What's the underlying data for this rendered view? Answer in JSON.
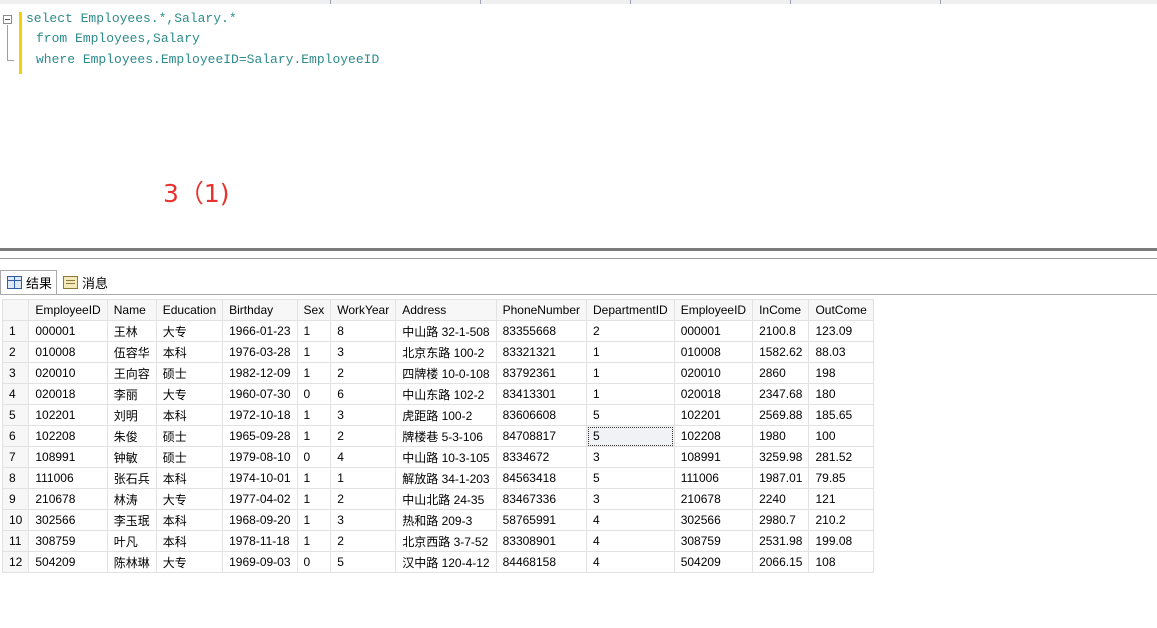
{
  "editor": {
    "lines": [
      {
        "keyword": "select",
        "rest": " Employees.*,Salary.*"
      },
      {
        "keyword": "from",
        "rest": " Employees,Salary"
      },
      {
        "keyword": "where",
        "rest": " Employees.EmployeeID=Salary.EmployeeID"
      }
    ],
    "annotation": "3（1)"
  },
  "result_tabs": [
    {
      "label": "结果",
      "icon": "grid-icon"
    },
    {
      "label": "消息",
      "icon": "message-icon"
    }
  ],
  "grid": {
    "columns": [
      "",
      "EmployeeID",
      "Name",
      "Education",
      "Birthday",
      "Sex",
      "WorkYear",
      "Address",
      "PhoneNumber",
      "DepartmentID",
      "EmployeeID",
      "InCome",
      "OutCome"
    ],
    "rows": [
      [
        "1",
        "000001",
        "王林",
        "大专",
        "1966-01-23",
        "1",
        "8",
        "中山路 32-1-508",
        "83355668",
        "2",
        "000001",
        "2100.8",
        "123.09"
      ],
      [
        "2",
        "010008",
        "伍容华",
        "本科",
        "1976-03-28",
        "1",
        "3",
        "北京东路 100-2",
        "83321321",
        "1",
        "010008",
        "1582.62",
        "88.03"
      ],
      [
        "3",
        "020010",
        "王向容",
        "硕士",
        "1982-12-09",
        "1",
        "2",
        "四牌楼 10-0-108",
        "83792361",
        "1",
        "020010",
        "2860",
        "198"
      ],
      [
        "4",
        "020018",
        "李丽",
        "大专",
        "1960-07-30",
        "0",
        "6",
        "中山东路 102-2",
        "83413301",
        "1",
        "020018",
        "2347.68",
        "180"
      ],
      [
        "5",
        "102201",
        "刘明",
        "本科",
        "1972-10-18",
        "1",
        "3",
        "虎距路 100-2",
        "83606608",
        "5",
        "102201",
        "2569.88",
        "185.65"
      ],
      [
        "6",
        "102208",
        "朱俊",
        "硕士",
        "1965-09-28",
        "1",
        "2",
        "牌楼巷 5-3-106",
        "84708817",
        "5",
        "102208",
        "1980",
        "100"
      ],
      [
        "7",
        "108991",
        "钟敏",
        "硕士",
        "1979-08-10",
        "0",
        "4",
        "中山路 10-3-105",
        "8334672",
        "3",
        "108991",
        "3259.98",
        "281.52"
      ],
      [
        "8",
        "111006",
        "张石兵",
        "本科",
        "1974-10-01",
        "1",
        "1",
        "解放路 34-1-203",
        "84563418",
        "5",
        "111006",
        "1987.01",
        "79.85"
      ],
      [
        "9",
        "210678",
        "林涛",
        "大专",
        "1977-04-02",
        "1",
        "2",
        "中山北路 24-35",
        "83467336",
        "3",
        "210678",
        "2240",
        "121"
      ],
      [
        "10",
        "302566",
        "李玉珉",
        "本科",
        "1968-09-20",
        "1",
        "3",
        "热和路 209-3",
        "58765991",
        "4",
        "302566",
        "2980.7",
        "210.2"
      ],
      [
        "11",
        "308759",
        "叶凡",
        "本科",
        "1978-11-18",
        "1",
        "2",
        "北京西路 3-7-52",
        "83308901",
        "4",
        "308759",
        "2531.98",
        "199.08"
      ],
      [
        "12",
        "504209",
        "陈林琳",
        "大专",
        "1969-09-03",
        "0",
        "5",
        "汉中路 120-4-12",
        "84468158",
        "4",
        "504209",
        "2066.15",
        "108"
      ]
    ],
    "selected_cell": {
      "row": 5,
      "col": 9
    }
  },
  "colors": {
    "keyword": "#2e8b8b",
    "annotation": "#e8322e",
    "change_bar": "#f2d200"
  }
}
